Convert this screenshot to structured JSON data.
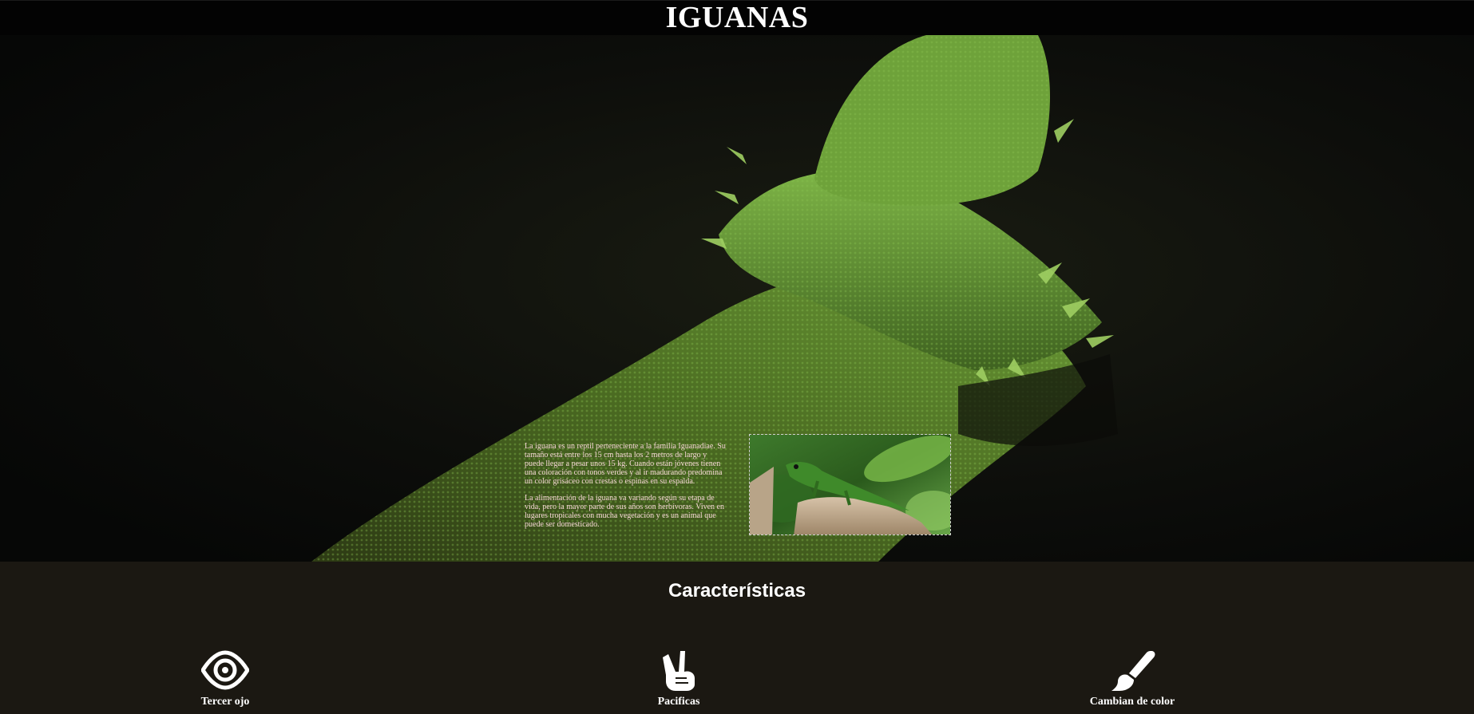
{
  "header": {
    "title": "IGUANAS"
  },
  "intro": {
    "paragraph_1": "La iguana es un reptil perteneciente a la familia Iguanadiae. Su tamaño está entre los 15 cm hasta los 2 metros de largo y puede llegar a pesar unos 15 kg. Cuando están jóvenes tienen una coloración con tonos verdes y al ir madurando predomina un color grisáceo con crestas o espinas en su espalda.",
    "paragraph_2": "La alimentación de la iguana va variando según su etapa de vida, pero la mayor parte de sus años son herbívoras. Viven en lugares tropicales con mucha vegetación y es un animal que puede ser domesticado."
  },
  "features": {
    "title": "Características",
    "items": [
      {
        "label": "Tercer ojo",
        "icon": "eye-icon"
      },
      {
        "label": "Pacificas",
        "icon": "peace-hand-icon"
      },
      {
        "label": "Cambian de color",
        "icon": "paint-brush-icon"
      }
    ]
  },
  "colors": {
    "header_bg": "#030303",
    "features_bg": "#1b1812",
    "text_light": "#ffffff",
    "intro_text": "#f6d6d6",
    "iguana_green": "#4f7a2a"
  }
}
